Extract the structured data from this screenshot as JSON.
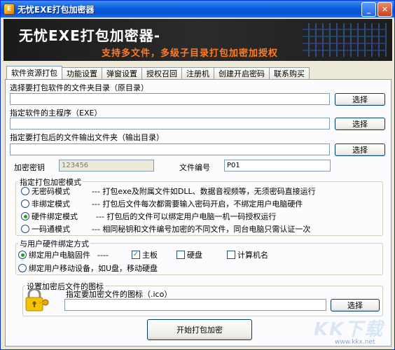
{
  "window": {
    "title": "无忧EXE打包加密器"
  },
  "banner": {
    "title": "无忧EXE打包加密器-",
    "subtitle": "支持多文件，多级子目录打包加密加授权"
  },
  "tabs": [
    {
      "label": "软件资源打包"
    },
    {
      "label": "功能设置"
    },
    {
      "label": "弹窗设置"
    },
    {
      "label": "授权召回"
    },
    {
      "label": "注册机"
    },
    {
      "label": "创建开启密码"
    },
    {
      "label": "联系购买"
    }
  ],
  "source": {
    "label": "选择要打包软件的文件夹目录（原目录）",
    "value": "",
    "button": "选择"
  },
  "main_exe": {
    "label": "指定软件的主程序（EXE）",
    "value": "",
    "button": "选择"
  },
  "output": {
    "label": "指定要打包后的文件输出文件夹（输出目录）",
    "value": "",
    "button": "选择"
  },
  "key": {
    "label": "加密密钥",
    "value": "123456"
  },
  "file_no": {
    "label": "文件编号",
    "value": "P01"
  },
  "mode_group": {
    "title": "指定打包加密模式",
    "options": [
      {
        "label": "无密码模式",
        "desc": "---   打包exe及附属文件如DLL、数据音视频等，无须密码直接运行",
        "selected": false
      },
      {
        "label": "非绑定模式",
        "desc": "---   打包后文件每次都需要输入密码开启，不绑定用户电脑硬件",
        "selected": false
      },
      {
        "label": "硬件绑定模式",
        "desc": "---   打包后的文件可以绑定用户电脑一机一码授权运行",
        "selected": true
      },
      {
        "label": "一码通模式",
        "desc": "---   相同秘钥和文件编号加密的不同文件，同台电脑只需认证一次",
        "selected": false
      }
    ]
  },
  "bind_group": {
    "title": "与用户硬件绑定方式",
    "pc_option": "绑定用户电脑固件",
    "dashes": "----",
    "checks": [
      {
        "label": "主板",
        "checked": true
      },
      {
        "label": "硬盘",
        "checked": false
      },
      {
        "label": "计算机名",
        "checked": false
      }
    ],
    "mobile_option": "绑定用户移动设备，如U盘，移动硬盘"
  },
  "icon_group": {
    "title": "设置加密后文件的图标",
    "label": "指定要加密文件的图标（.ico）",
    "value": "",
    "button": "选择"
  },
  "start_button": "开始打包加密",
  "watermark": {
    "brand": "KK下载",
    "url": "www.kkx.net"
  }
}
